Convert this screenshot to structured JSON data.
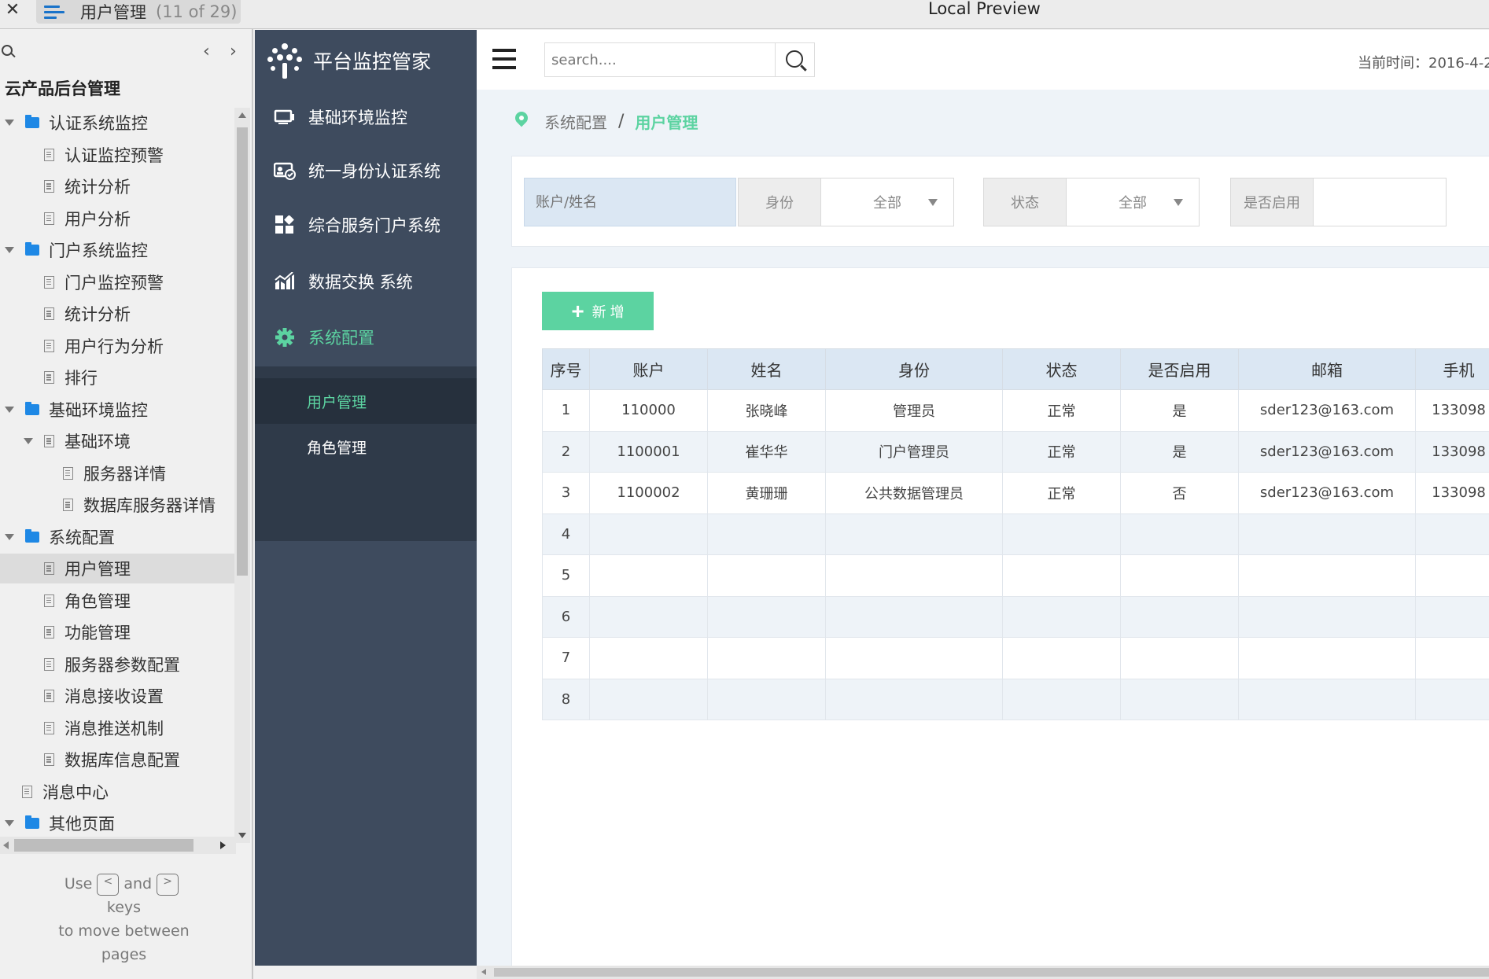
{
  "window": {
    "close_glyph": "✕",
    "tab_title": "用户管理",
    "tab_count": "(11 of 29)",
    "title": "Local Preview"
  },
  "preview": {
    "prev_glyph": "‹",
    "next_glyph": "›",
    "root_label": "云产品后台管理",
    "tree": [
      {
        "label": "认证系统监控",
        "type": "folder",
        "level": 0
      },
      {
        "label": "认证监控预警",
        "type": "page",
        "level": 1
      },
      {
        "label": "统计分析",
        "type": "page",
        "level": 1
      },
      {
        "label": "用户分析",
        "type": "page",
        "level": 1
      },
      {
        "label": "门户系统监控",
        "type": "folder",
        "level": 0
      },
      {
        "label": "门户监控预警",
        "type": "page",
        "level": 1
      },
      {
        "label": "统计分析",
        "type": "page",
        "level": 1
      },
      {
        "label": "用户行为分析",
        "type": "page",
        "level": 1
      },
      {
        "label": "排行",
        "type": "page",
        "level": 1
      },
      {
        "label": "基础环境监控",
        "type": "folder",
        "level": 0
      },
      {
        "label": "基础环境",
        "type": "page-group",
        "level": 1
      },
      {
        "label": "服务器详情",
        "type": "page",
        "level": 2
      },
      {
        "label": "数据库服务器详情",
        "type": "page",
        "level": 2
      },
      {
        "label": "系统配置",
        "type": "folder",
        "level": 0
      },
      {
        "label": "用户管理",
        "type": "page",
        "level": 1,
        "selected": true
      },
      {
        "label": "角色管理",
        "type": "page",
        "level": 1
      },
      {
        "label": "功能管理",
        "type": "page",
        "level": 1
      },
      {
        "label": "服务器参数配置",
        "type": "page",
        "level": 1
      },
      {
        "label": "消息接收设置",
        "type": "page",
        "level": 1
      },
      {
        "label": "消息推送机制",
        "type": "page",
        "level": 1
      },
      {
        "label": "数据库信息配置",
        "type": "page",
        "level": 1
      },
      {
        "label": "消息中心",
        "type": "page",
        "level": 0
      },
      {
        "label": "其他页面",
        "type": "folder",
        "level": 0
      }
    ],
    "hint_use": "Use",
    "hint_key_prev": "<",
    "hint_and": "and",
    "hint_key_next": ">",
    "hint_keys": "keys",
    "hint_move": "to move between",
    "hint_pages": "pages"
  },
  "sidebar": {
    "brand": "平台监控管家",
    "items": [
      {
        "label": "基础环境监控",
        "icon": "monitor-icon"
      },
      {
        "label": "统一身份认证系统",
        "icon": "id-card-icon"
      },
      {
        "label": "综合服务门户系统",
        "icon": "grid-icon"
      },
      {
        "label": "数据交换 系统",
        "icon": "chart-icon"
      },
      {
        "label": "系统配置",
        "icon": "gear-icon",
        "active": true
      }
    ],
    "sub_items": [
      {
        "label": "用户管理",
        "active": true
      },
      {
        "label": "角色管理"
      }
    ],
    "accent_color": "#5cd3a1"
  },
  "header": {
    "search_placeholder": "search....",
    "clock_label": "当前时间：2016-4-2"
  },
  "breadcrumb": {
    "parent": "系统配置",
    "separator": "/",
    "current": "用户管理"
  },
  "filters": {
    "account_placeholder": "账户/姓名",
    "identity_label": "身份",
    "identity_value": "全部",
    "status_label": "状态",
    "status_value": "全部",
    "enabled_label": "是否启用"
  },
  "table": {
    "add_label": "新 增",
    "columns": [
      "序号",
      "账户",
      "姓名",
      "身份",
      "状态",
      "是否启用",
      "邮箱",
      "手机"
    ],
    "rows": [
      [
        "1",
        "110000",
        "张晓峰",
        "管理员",
        "正常",
        "是",
        "sder123@163.com",
        "133098"
      ],
      [
        "2",
        "1100001",
        "崔华华",
        "门户管理员",
        "正常",
        "是",
        "sder123@163.com",
        "133098"
      ],
      [
        "3",
        "1100002",
        "黄珊珊",
        "公共数据管理员",
        "正常",
        "否",
        "sder123@163.com",
        "133098"
      ],
      [
        "4",
        "",
        "",
        "",
        "",
        "",
        "",
        ""
      ],
      [
        "5",
        "",
        "",
        "",
        "",
        "",
        "",
        ""
      ],
      [
        "6",
        "",
        "",
        "",
        "",
        "",
        "",
        ""
      ],
      [
        "7",
        "",
        "",
        "",
        "",
        "",
        "",
        ""
      ],
      [
        "8",
        "",
        "",
        "",
        "",
        "",
        "",
        ""
      ]
    ]
  }
}
